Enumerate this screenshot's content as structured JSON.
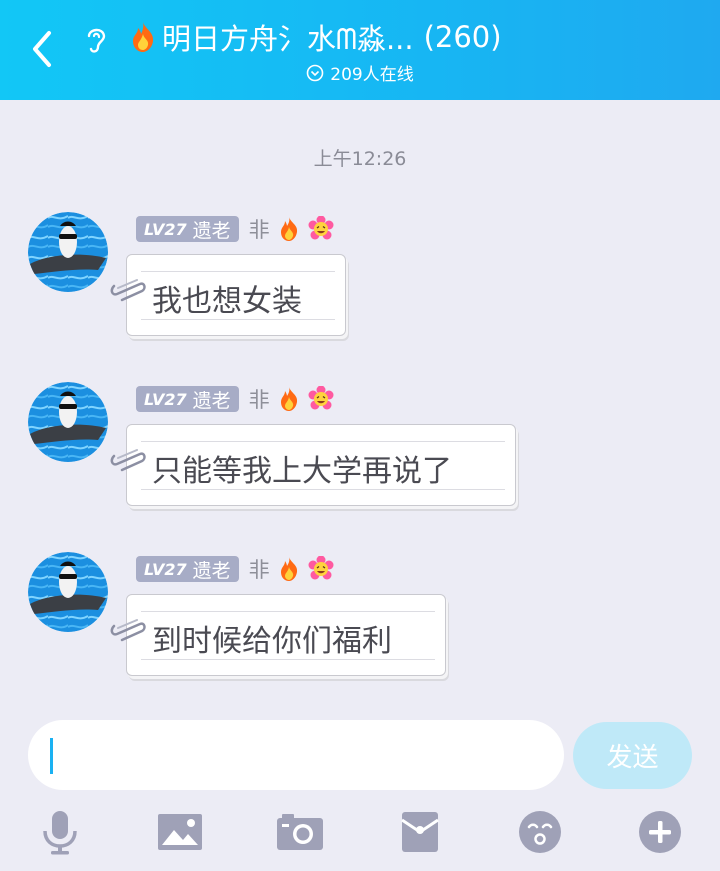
{
  "header": {
    "title": "明日方舟氵水ᗰ淼...",
    "count": "(260)",
    "online": "209人在线"
  },
  "chat": {
    "time": "上午12:26",
    "messages": [
      {
        "level": "LV27",
        "title": "遗老",
        "name": "非",
        "text": "我也想女装"
      },
      {
        "level": "LV27",
        "title": "遗老",
        "name": "非",
        "text": "只能等我上大学再说了"
      },
      {
        "level": "LV27",
        "title": "遗老",
        "name": "非",
        "text": "到时候给你们福利"
      }
    ]
  },
  "input": {
    "value": "",
    "send_label": "发送"
  },
  "toolbar": {
    "icons": [
      "microphone-icon",
      "image-icon",
      "camera-icon",
      "red-packet-icon",
      "emoji-icon",
      "plus-icon"
    ]
  },
  "colors": {
    "header_start": "#12c7f6",
    "header_end": "#1fa9f0",
    "background": "#ececf5",
    "badge": "#a7acc6",
    "send_button": "#bfe9f8",
    "caret": "#1ab1f2"
  }
}
